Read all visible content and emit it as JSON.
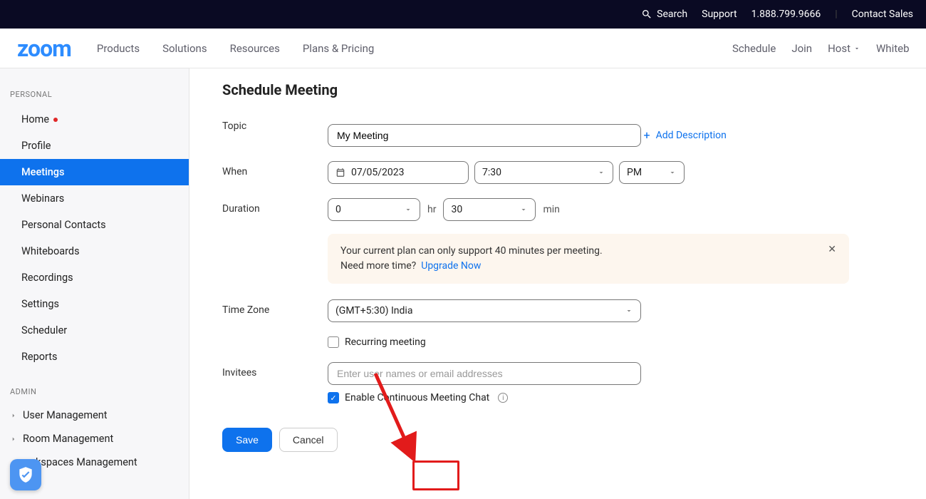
{
  "topbar": {
    "search": "Search",
    "support": "Support",
    "phone": "1.888.799.9666",
    "contact": "Contact Sales"
  },
  "logo": "zoom",
  "nav": {
    "products": "Products",
    "solutions": "Solutions",
    "resources": "Resources",
    "plans": "Plans & Pricing",
    "schedule": "Schedule",
    "join": "Join",
    "host": "Host",
    "whiteboard": "Whiteboard"
  },
  "sidebar": {
    "personal_head": "PERSONAL",
    "admin_head": "ADMIN",
    "items": {
      "home": "Home",
      "profile": "Profile",
      "meetings": "Meetings",
      "webinars": "Webinars",
      "personal_contacts": "Personal Contacts",
      "whiteboards": "Whiteboards",
      "recordings": "Recordings",
      "settings": "Settings",
      "scheduler": "Scheduler",
      "reports": "Reports"
    },
    "admin": {
      "user_mgmt": "User Management",
      "room_mgmt": "Room Management",
      "ws_mgmt": "kspaces Management"
    }
  },
  "page": {
    "title": "Schedule Meeting",
    "labels": {
      "topic": "Topic",
      "when": "When",
      "duration": "Duration",
      "tz": "Time Zone",
      "invitees": "Invitees",
      "recurring": "Recurring meeting",
      "cont_chat": "Enable Continuous Meeting Chat",
      "hr": "hr",
      "min": "min"
    },
    "values": {
      "topic": "My Meeting",
      "date": "07/05/2023",
      "time": "7:30",
      "ampm": "PM",
      "dur_hr": "0",
      "dur_min": "30",
      "tz": "(GMT+5:30) India"
    },
    "placeholders": {
      "invitees": "Enter user names or email addresses"
    },
    "add_desc": "Add Description",
    "banner": {
      "line1": "Your current plan can only support 40 minutes per meeting.",
      "line2_a": "Need more time?",
      "cta": "Upgrade Now"
    },
    "buttons": {
      "save": "Save",
      "cancel": "Cancel"
    }
  }
}
